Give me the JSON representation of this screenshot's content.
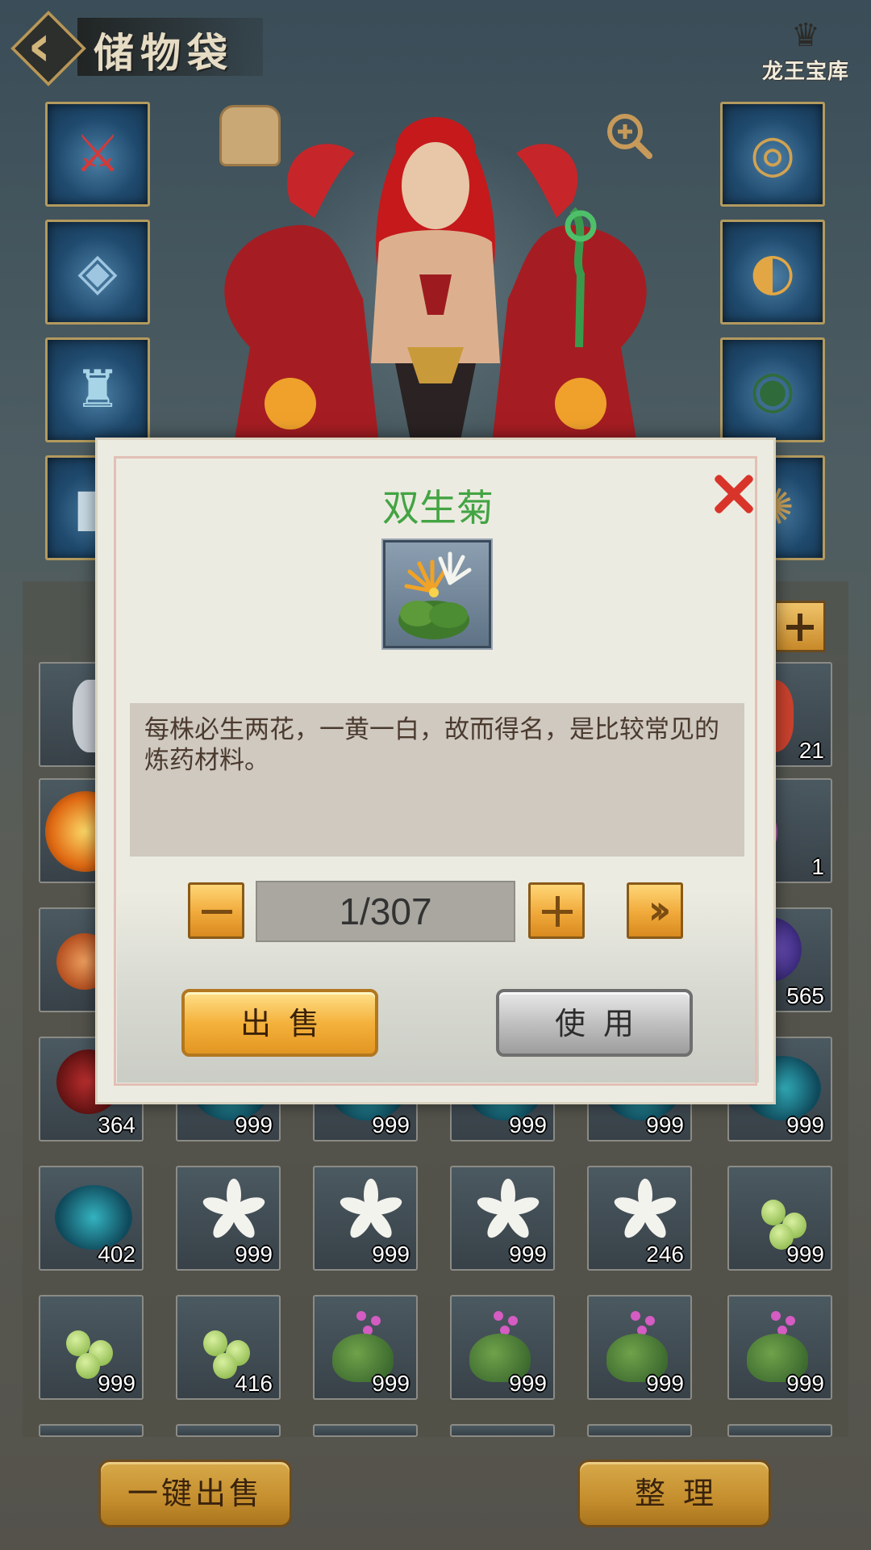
{
  "header": {
    "title": "储物袋",
    "logo_text": "龙王宝库"
  },
  "equipment": {
    "left_slots": [
      "sword-icon",
      "helmet-icon",
      "armor-icon",
      "boots-icon"
    ],
    "right_slots": [
      "ring-icon",
      "amulet-icon",
      "bracelet-icon",
      "talisman-icon"
    ]
  },
  "dialog": {
    "item_name": "双生菊",
    "item_name_color": "#43a443",
    "description": "每株必生两花，一黄一白，故而得名，是比较常见的炼药材料。",
    "quantity": "1/307",
    "sell_label": "出售",
    "use_label": "使用"
  },
  "bag": {
    "partial_counts": [
      "21",
      "1",
      "565"
    ],
    "rows": [
      [
        "364",
        "999",
        "999",
        "999",
        "999",
        "999"
      ],
      [
        "402",
        "999",
        "999",
        "999",
        "246",
        "999"
      ],
      [
        "999",
        "416",
        "999",
        "999",
        "999",
        "999"
      ]
    ]
  },
  "footer": {
    "sell_all_label": "一键出售",
    "sort_label": "整理"
  },
  "colors": {
    "accent_gold": "#c58e2d",
    "title_green": "#43a443",
    "close_red": "#d9342a"
  }
}
